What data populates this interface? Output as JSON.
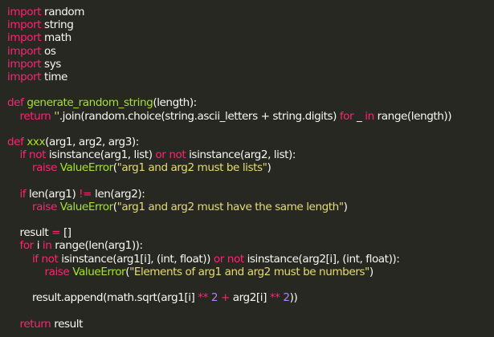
{
  "editor": {
    "colors": {
      "background": "#272822",
      "keyword": "#f92672",
      "function": "#a6e22e",
      "class": "#a6e22e",
      "string": "#e6db74",
      "number": "#ae81ff",
      "default": "#f8f8f2"
    },
    "lines": [
      [
        {
          "t": "import",
          "c": "keyword"
        },
        {
          "t": " random"
        }
      ],
      [
        {
          "t": "import",
          "c": "keyword"
        },
        {
          "t": " string"
        }
      ],
      [
        {
          "t": "import",
          "c": "keyword"
        },
        {
          "t": " math"
        }
      ],
      [
        {
          "t": "import",
          "c": "keyword"
        },
        {
          "t": " os"
        }
      ],
      [
        {
          "t": "import",
          "c": "keyword"
        },
        {
          "t": " sys"
        }
      ],
      [
        {
          "t": "import",
          "c": "keyword"
        },
        {
          "t": " time"
        }
      ],
      [],
      [
        {
          "t": "def",
          "c": "keyword"
        },
        {
          "t": " "
        },
        {
          "t": "generate_random_string",
          "c": "func"
        },
        {
          "t": "(length):"
        }
      ],
      [
        {
          "t": "    "
        },
        {
          "t": "return",
          "c": "keyword"
        },
        {
          "t": " "
        },
        {
          "t": "''",
          "c": "string"
        },
        {
          "t": ".join(random.choice(string.ascii_letters + string.digits) "
        },
        {
          "t": "for",
          "c": "keyword"
        },
        {
          "t": " _ "
        },
        {
          "t": "in",
          "c": "keyword"
        },
        {
          "t": " range(length))"
        }
      ],
      [],
      [
        {
          "t": "def",
          "c": "keyword"
        },
        {
          "t": " "
        },
        {
          "t": "xxx",
          "c": "func"
        },
        {
          "t": "(arg1, arg2, arg3):"
        }
      ],
      [
        {
          "t": "    "
        },
        {
          "t": "if",
          "c": "keyword"
        },
        {
          "t": " "
        },
        {
          "t": "not",
          "c": "keyword"
        },
        {
          "t": " isinstance(arg1, list) "
        },
        {
          "t": "or",
          "c": "keyword"
        },
        {
          "t": " "
        },
        {
          "t": "not",
          "c": "keyword"
        },
        {
          "t": " isinstance(arg2, list):"
        }
      ],
      [
        {
          "t": "        "
        },
        {
          "t": "raise",
          "c": "keyword"
        },
        {
          "t": " "
        },
        {
          "t": "ValueError",
          "c": "class"
        },
        {
          "t": "("
        },
        {
          "t": "\"arg1 and arg2 must be lists\"",
          "c": "string"
        },
        {
          "t": ")"
        }
      ],
      [],
      [
        {
          "t": "    "
        },
        {
          "t": "if",
          "c": "keyword"
        },
        {
          "t": " len(arg1) "
        },
        {
          "t": "!=",
          "c": "keyword"
        },
        {
          "t": " len(arg2):"
        }
      ],
      [
        {
          "t": "        "
        },
        {
          "t": "raise",
          "c": "keyword"
        },
        {
          "t": " "
        },
        {
          "t": "ValueError",
          "c": "class"
        },
        {
          "t": "("
        },
        {
          "t": "\"arg1 and arg2 must have the same length\"",
          "c": "string"
        },
        {
          "t": ")"
        }
      ],
      [],
      [
        {
          "t": "    result "
        },
        {
          "t": "=",
          "c": "keyword"
        },
        {
          "t": " []"
        }
      ],
      [
        {
          "t": "    "
        },
        {
          "t": "for",
          "c": "keyword"
        },
        {
          "t": " i "
        },
        {
          "t": "in",
          "c": "keyword"
        },
        {
          "t": " range(len(arg1)):"
        }
      ],
      [
        {
          "t": "        "
        },
        {
          "t": "if",
          "c": "keyword"
        },
        {
          "t": " "
        },
        {
          "t": "not",
          "c": "keyword"
        },
        {
          "t": " isinstance(arg1[i], (int, float)) "
        },
        {
          "t": "or",
          "c": "keyword"
        },
        {
          "t": " "
        },
        {
          "t": "not",
          "c": "keyword"
        },
        {
          "t": " isinstance(arg2[i], (int, float)):"
        }
      ],
      [
        {
          "t": "            "
        },
        {
          "t": "raise",
          "c": "keyword"
        },
        {
          "t": " "
        },
        {
          "t": "ValueError",
          "c": "class"
        },
        {
          "t": "("
        },
        {
          "t": "\"Elements of arg1 and arg2 must be numbers\"",
          "c": "string"
        },
        {
          "t": ")"
        }
      ],
      [],
      [
        {
          "t": "        result.append(math.sqrt(arg1[i] "
        },
        {
          "t": "**",
          "c": "keyword"
        },
        {
          "t": " "
        },
        {
          "t": "2",
          "c": "number"
        },
        {
          "t": " "
        },
        {
          "t": "+",
          "c": "keyword"
        },
        {
          "t": " arg2[i] "
        },
        {
          "t": "**",
          "c": "keyword"
        },
        {
          "t": " "
        },
        {
          "t": "2",
          "c": "number"
        },
        {
          "t": "))"
        }
      ],
      [],
      [
        {
          "t": "    "
        },
        {
          "t": "return",
          "c": "keyword"
        },
        {
          "t": " result"
        }
      ]
    ]
  }
}
